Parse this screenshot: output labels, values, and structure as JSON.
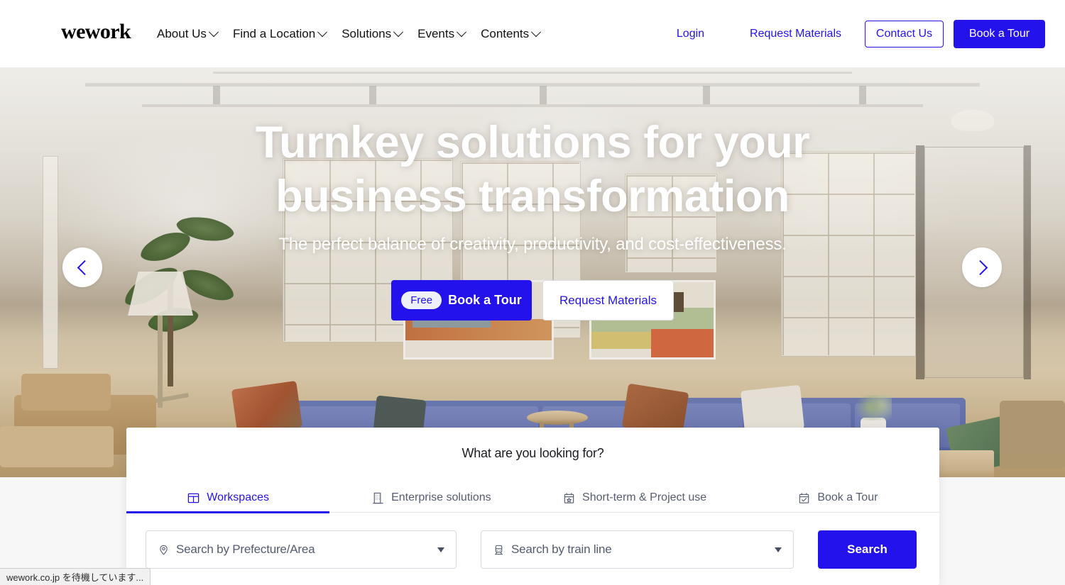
{
  "header": {
    "logo_text": "wework",
    "nav_items": [
      {
        "label": "About Us",
        "icon": "chevron-down-icon"
      },
      {
        "label": "Find a Location",
        "icon": "chevron-down-icon"
      },
      {
        "label": "Solutions",
        "icon": "chevron-down-icon"
      },
      {
        "label": "Events",
        "icon": "chevron-down-icon"
      },
      {
        "label": "Contents",
        "icon": "chevron-down-icon"
      }
    ],
    "login_label": "Login",
    "request_materials_label": "Request Materials",
    "contact_us_label": "Contact Us",
    "book_a_tour_label": "Book a Tour"
  },
  "hero": {
    "title_line1": "Turnkey solutions for your",
    "title_line2": "business transformation",
    "subtitle": "The perfect balance of creativity, productivity, and cost-effectiveness.",
    "cta_primary_badge": "Free",
    "cta_primary_label": "Book a Tour",
    "cta_secondary_label": "Request Materials",
    "prev_icon": "chevron-left-icon",
    "next_icon": "chevron-right-icon"
  },
  "search_panel": {
    "heading": "What are you looking for?",
    "tabs": [
      {
        "label": "Workspaces",
        "icon": "desk-icon",
        "active": true
      },
      {
        "label": "Enterprise solutions",
        "icon": "office-building-icon",
        "active": false
      },
      {
        "label": "Short-term & Project use",
        "icon": "calendar-star-icon",
        "active": false
      },
      {
        "label": "Book a Tour",
        "icon": "calendar-check-icon",
        "active": false
      }
    ],
    "area_field": {
      "placeholder": "Search by Prefecture/Area",
      "icon": "location-pin-icon",
      "caret": "caret-down-icon"
    },
    "trainline_field": {
      "placeholder": "Search by train line",
      "icon": "train-icon",
      "caret": "caret-down-icon"
    },
    "search_button_label": "Search"
  },
  "browser": {
    "status_text": "wework.co.jp を待機しています..."
  },
  "colors": {
    "accent_blue": "#2412ec",
    "text_dark": "#111111",
    "tab_inactive": "#555c70",
    "page_bg": "#f7f7f8"
  }
}
